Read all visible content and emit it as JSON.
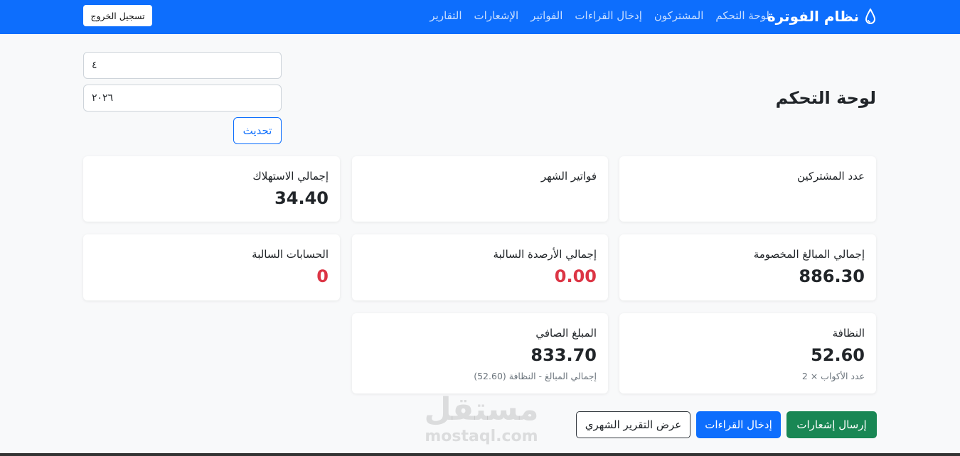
{
  "navbar": {
    "brand": "نظام الفوترة",
    "links": [
      "لوحة التحكم",
      "المشتركون",
      "إدخال القراءات",
      "الفواتير",
      "الإشعارات",
      "التقارير"
    ],
    "logout": "تسجيل الخروج",
    "bg_color": "#0d6efd"
  },
  "page": {
    "title": "لوحة التحكم"
  },
  "filters": {
    "month": "٤",
    "year": "٢٠٢٦",
    "refresh": "تحديث"
  },
  "cards": {
    "subscribers": {
      "label": "عدد المشتركين",
      "value": ""
    },
    "month_bills": {
      "label": "فواتير الشهر",
      "value": ""
    },
    "consumption": {
      "label": "إجمالي الاستهلاك",
      "value": "34.40"
    },
    "deductions": {
      "label": "إجمالي المبالغ المخصومة",
      "value": "886.30"
    },
    "negative_balances": {
      "label": "إجمالي الأرصدة السالبة",
      "value": "0.00"
    },
    "negative_accounts": {
      "label": "الحسابات السالبة",
      "value": "0"
    },
    "cleaning": {
      "label": "النظافة",
      "value": "52.60",
      "note": "عدد الأكواب × 2"
    },
    "net_amount": {
      "label": "المبلغ الصافي",
      "value": "833.70",
      "note": "إجمالي المبالغ - النظافة (52.60)"
    }
  },
  "actions": {
    "send_notifications": "إرسال إشعارات",
    "enter_readings": "إدخال القراءات",
    "monthly_report": "عرض التقرير الشهري"
  },
  "watermark": {
    "ar": "مستقل",
    "en": "mostaql.com"
  },
  "colors": {
    "primary": "#0d6efd",
    "danger": "#dc3545",
    "success": "#198754"
  }
}
